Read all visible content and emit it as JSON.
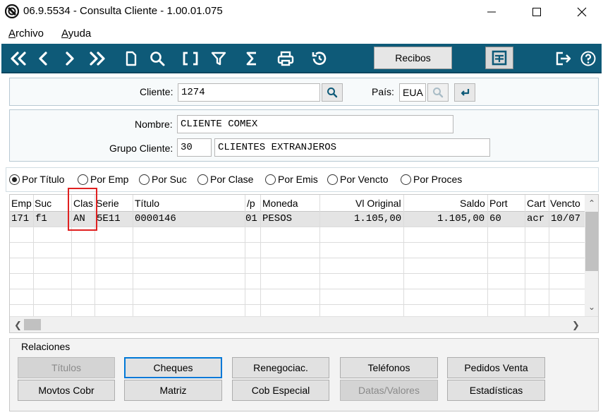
{
  "window": {
    "title": "06.9.5534 - Consulta Cliente - 1.00.01.075"
  },
  "menu": [
    {
      "accel": "A",
      "rest": "rchivo"
    },
    {
      "accel": "A",
      "rest": "yuda"
    }
  ],
  "toolbar": {
    "icons": [
      "first-icon",
      "prev-icon",
      "next-icon",
      "last-icon",
      "new-doc-icon",
      "search-icon",
      "brackets-icon",
      "filter-icon",
      "sum-icon",
      "print-icon",
      "history-icon"
    ],
    "recibos_label": "Recibos",
    "right_icons": [
      "calculator-icon",
      "exit-icon",
      "help-icon"
    ],
    "color": "#0e5a78"
  },
  "cliente": {
    "label": "Cliente:",
    "value": "1274",
    "pais_label": "País:",
    "pais_value": "EUA"
  },
  "nombre": {
    "label": "Nombre:",
    "value": "CLIENTE COMEX"
  },
  "grupo": {
    "label": "Grupo Cliente:",
    "code": "30",
    "name": "CLIENTES EXTRANJEROS"
  },
  "radios": [
    {
      "label": "Por Título",
      "selected": true
    },
    {
      "label": "Por Emp",
      "selected": false
    },
    {
      "label": "Por Suc",
      "selected": false
    },
    {
      "label": "Por Clase",
      "selected": false
    },
    {
      "label": "Por Emis",
      "selected": false
    },
    {
      "label": "Por Vencto",
      "selected": false
    },
    {
      "label": "Por Proces",
      "selected": false
    }
  ],
  "grid": {
    "columns": [
      "Emp",
      "Suc",
      "Clas",
      "Serie",
      "Título",
      "/p",
      "Moneda",
      "Vl Original",
      "Saldo",
      "Port",
      "Cart",
      "Vencto"
    ],
    "rows": [
      [
        "171",
        "f1",
        "AN",
        "5E11",
        "0000146",
        "01",
        "PESOS",
        "1.105,00",
        "1.105,00",
        "60",
        "acr",
        "10/07"
      ]
    ]
  },
  "relaciones": {
    "title": "Relaciones",
    "buttons": [
      {
        "label": "Títulos",
        "enabled": false
      },
      {
        "label": "Cheques",
        "enabled": true,
        "focused": true
      },
      {
        "label": "Renegociac.",
        "enabled": true
      },
      {
        "label": "Teléfonos",
        "enabled": true
      },
      {
        "label": "Pedidos Venta",
        "enabled": true
      },
      {
        "label": "Movtos Cobr",
        "enabled": true
      },
      {
        "label": "Matriz",
        "enabled": true
      },
      {
        "label": "Cob Especial",
        "enabled": true
      },
      {
        "label": "Datas/Valores",
        "enabled": false
      },
      {
        "label": "Estadísticas",
        "enabled": true
      }
    ]
  },
  "highlight_color": "#e02020"
}
